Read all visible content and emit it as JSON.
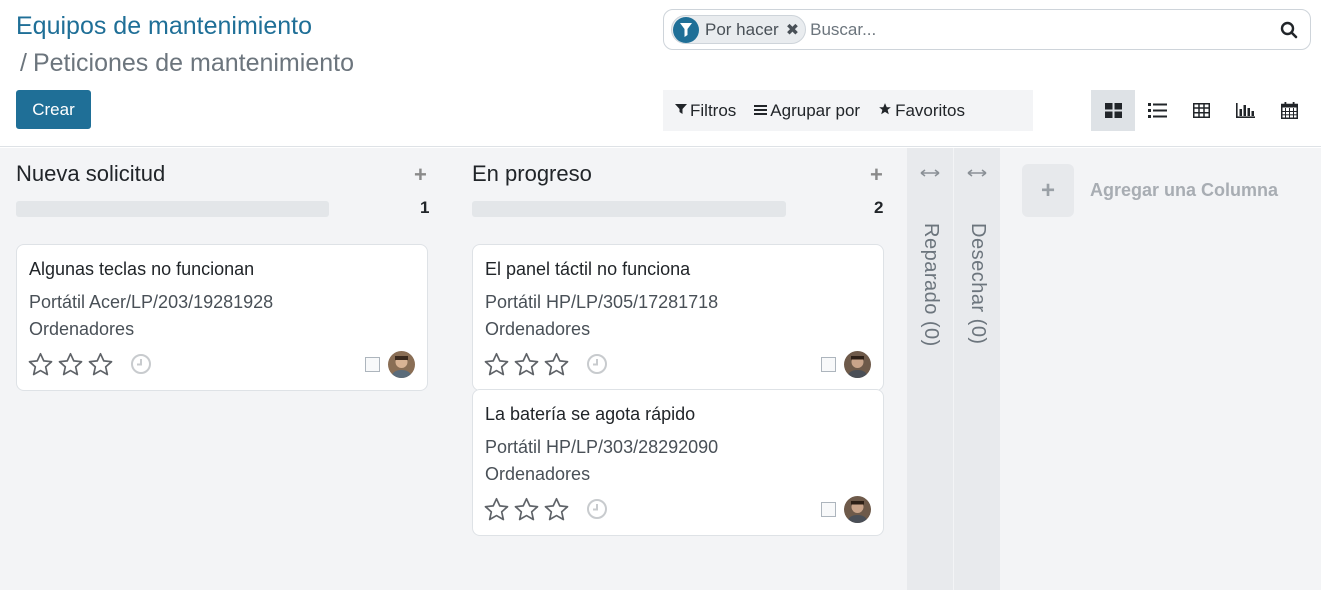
{
  "breadcrumb": {
    "root": "Equipos de mantenimiento",
    "separator": "/",
    "current": "Peticiones de mantenimiento"
  },
  "actions": {
    "create_label": "Crear"
  },
  "search": {
    "facet_label": "Por hacer",
    "placeholder": "Buscar..."
  },
  "filters": {
    "filters_label": "Filtros",
    "group_by_label": "Agrupar por",
    "favorites_label": "Favoritos"
  },
  "views": [
    "kanban",
    "list",
    "pivot",
    "graph",
    "calendar"
  ],
  "active_view": "kanban",
  "columns": [
    {
      "title": "Nueva solicitud",
      "count": "1",
      "cards": [
        {
          "title": "Algunas teclas no funcionan",
          "equipment": "Portátil Acer/LP/203/19281928",
          "category": "Ordenadores",
          "stars": 0
        }
      ]
    },
    {
      "title": "En progreso",
      "count": "2",
      "cards": [
        {
          "title": "El panel táctil no funciona",
          "equipment": "Portátil HP/LP/305/17281718",
          "category": "Ordenadores",
          "stars": 0
        },
        {
          "title": "La batería se agota rápido",
          "equipment": "Portátil HP/LP/303/28292090",
          "category": "Ordenadores",
          "stars": 0
        }
      ]
    }
  ],
  "folded_columns": [
    {
      "label": "Reparado (0)"
    },
    {
      "label": "Desechar (0)"
    }
  ],
  "add_column_label": "Agregar una Columna",
  "colors": {
    "primary": "#1f6f97",
    "background": "#f3f4f6",
    "muted": "#6c757d"
  }
}
